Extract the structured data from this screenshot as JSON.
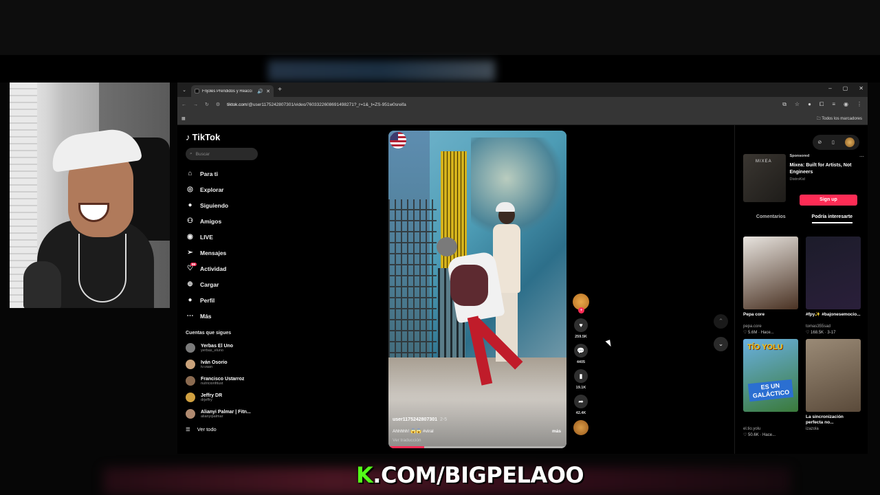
{
  "browser": {
    "tab_title": "Frijoles Prendidos y Reacci",
    "new_tab": "+",
    "url_host": "tiktok.com",
    "url_path": "/@user1175242807301/video/7603322608691498271?_r=1&_t=ZS-951w0sreifa",
    "bookmarks_label": "Todos los marcadores",
    "window_controls": [
      "–",
      "▢",
      "✕"
    ]
  },
  "tiktok": {
    "logo": "TikTok",
    "search_placeholder": "Buscar",
    "nav": [
      {
        "label": "Para ti",
        "icon": "home-icon"
      },
      {
        "label": "Explorar",
        "icon": "compass-icon"
      },
      {
        "label": "Siguiendo",
        "icon": "following-icon"
      },
      {
        "label": "Amigos",
        "icon": "friends-icon"
      },
      {
        "label": "LIVE",
        "icon": "live-icon"
      },
      {
        "label": "Mensajes",
        "icon": "send-icon"
      },
      {
        "label": "Actividad",
        "icon": "activity-icon",
        "badge": "99"
      },
      {
        "label": "Cargar",
        "icon": "upload-icon"
      },
      {
        "label": "Perfil",
        "icon": "profile-icon"
      },
      {
        "label": "Más",
        "icon": "more-icon"
      }
    ],
    "following_title": "Cuentas que sigues",
    "following": [
      {
        "name": "Yerbas El Uno",
        "handle": "yerbas_eluno",
        "color": "#7a7a7a"
      },
      {
        "name": "Iván Osorio",
        "handle": "iv.vaan",
        "color": "#c9a27a"
      },
      {
        "name": "Francisco Ustarroz",
        "handle": "nutricionfitust",
        "color": "#8a6a50"
      },
      {
        "name": "Jeffry DR",
        "handle": "drjeffry",
        "color": "#d0a040"
      },
      {
        "name": "Alianyi Palmar | Fitn...",
        "handle": "alianyipalmar",
        "color": "#b08a70"
      }
    ],
    "see_all": "Ver todo",
    "video": {
      "username": "user1175242807301",
      "date": "2-5",
      "caption": "Ahhhhh! 😱😱 #viral",
      "more": "más",
      "translate": "Ver traducción",
      "progress": 0.2
    },
    "actions": {
      "likes": "259.5K",
      "comments": "4405",
      "saves": "19.1K",
      "shares": "42.4K"
    },
    "sponsored": {
      "tag": "Sponsored",
      "title": "Mixea: Built for Artists, Not Engineers",
      "by": "DistroKid",
      "image_label": "MIXEA",
      "cta": "Sign up"
    },
    "right_tabs": [
      "Comentarios",
      "Podría interesarte"
    ],
    "suggestions": [
      {
        "title": "Pepa core",
        "author": "pepa.core",
        "meta": "♡ 5.6M · Hace...",
        "colors": [
          "#e8e4df",
          "#4a3223"
        ]
      },
      {
        "title": "#fpy✨ #bajonesemocio...",
        "author": "tomas355sad",
        "meta": "♡ 168.5K · 3-17",
        "colors": [
          "#1c1c2a",
          "#2a1f3a"
        ]
      },
      {
        "title": "",
        "author": "el.tio.yolu",
        "meta": "♡ 50.6K · Hace...",
        "colors": [
          "#6ab0e0",
          "#3a7a3a"
        ],
        "overlay": "TÍO YOLU",
        "overlay2": "ES UN GALÁCTICO"
      },
      {
        "title": "La sincronización perfecta no...",
        "author": "izazola",
        "meta": "",
        "colors": [
          "#9a8a76",
          "#5a4a3a"
        ]
      }
    ]
  },
  "overlay_banner": {
    "k": "K",
    "text": ".COM/BIGPELAOO"
  }
}
